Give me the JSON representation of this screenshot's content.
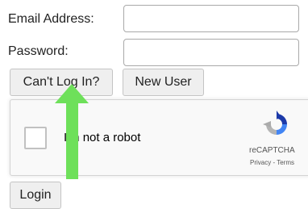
{
  "login_form": {
    "email_label": "Email Address:",
    "email_value": "",
    "password_label": "Password:",
    "password_value": "",
    "cant_login_button": "Can't Log In?",
    "new_user_button": "New User",
    "login_button": "Login"
  },
  "recaptcha": {
    "checkbox_label": "I'm not a robot",
    "brand": "reCAPTCHA",
    "privacy_link": "Privacy",
    "separator": " - ",
    "terms_link": "Terms",
    "icon": "recaptcha-logo-icon"
  },
  "annotation": {
    "icon": "up-arrow-icon",
    "color": "#6ee05a"
  }
}
